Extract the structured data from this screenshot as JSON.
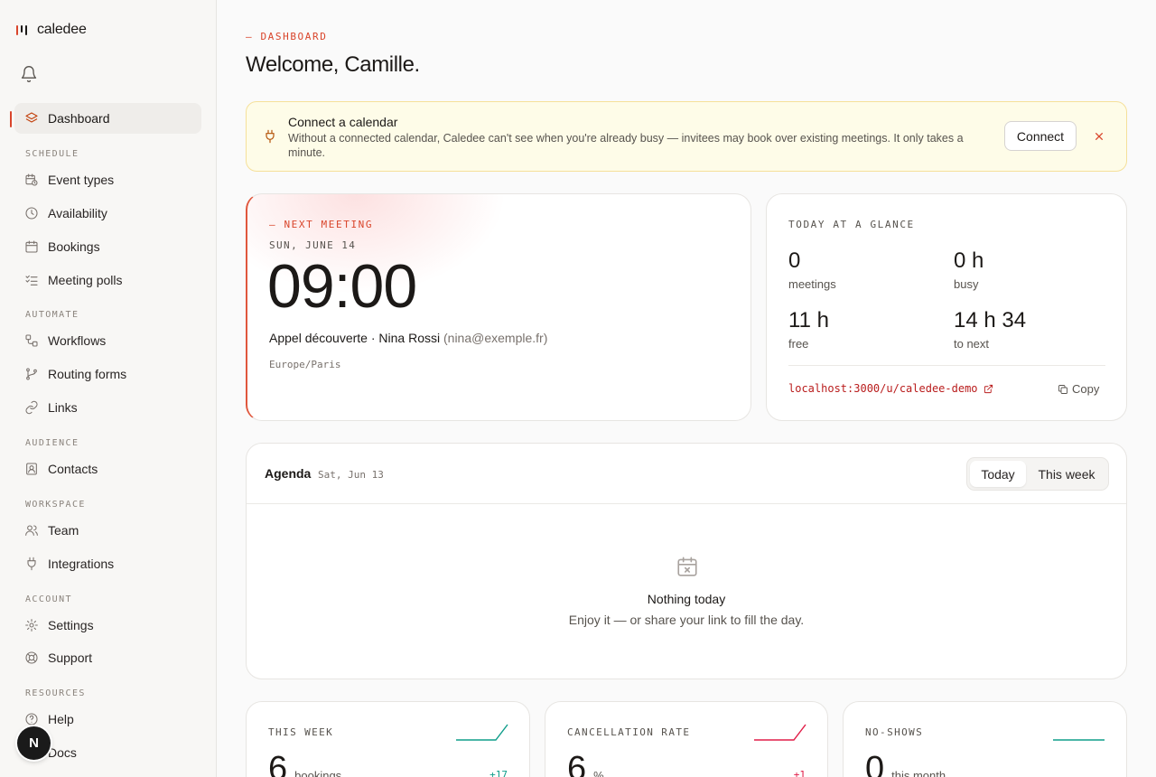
{
  "brand": {
    "name": "caledee"
  },
  "colors": {
    "accent": "#d9452b",
    "positive": "#0f9d8a",
    "negative": "#e11d48",
    "warning_bg": "#fefce8"
  },
  "sidebar": {
    "items": [
      {
        "key": "dashboard",
        "label": "Dashboard",
        "icon": "layers-icon",
        "active": true
      },
      {
        "key": "event-types",
        "label": "Event types",
        "icon": "calendar-clock-icon"
      },
      {
        "key": "availability",
        "label": "Availability",
        "icon": "clock-icon"
      },
      {
        "key": "bookings",
        "label": "Bookings",
        "icon": "calendar-icon"
      },
      {
        "key": "meeting-polls",
        "label": "Meeting polls",
        "icon": "checklist-icon"
      },
      {
        "key": "workflows",
        "label": "Workflows",
        "icon": "workflow-icon"
      },
      {
        "key": "routing-forms",
        "label": "Routing forms",
        "icon": "git-branch-icon"
      },
      {
        "key": "links",
        "label": "Links",
        "icon": "link-icon"
      },
      {
        "key": "contacts",
        "label": "Contacts",
        "icon": "contact-icon"
      },
      {
        "key": "team",
        "label": "Team",
        "icon": "users-icon"
      },
      {
        "key": "integrations",
        "label": "Integrations",
        "icon": "plug-icon"
      },
      {
        "key": "settings",
        "label": "Settings",
        "icon": "gear-icon"
      },
      {
        "key": "support",
        "label": "Support",
        "icon": "life-buoy-icon"
      },
      {
        "key": "help",
        "label": "Help",
        "icon": "help-circle-icon"
      },
      {
        "key": "docs",
        "label": "Docs",
        "icon": "book-icon"
      }
    ],
    "sections": {
      "schedule": "SCHEDULE",
      "automate": "AUTOMATE",
      "audience": "AUDIENCE",
      "workspace": "WORKSPACE",
      "account": "ACCOUNT",
      "resources": "RESOURCES"
    },
    "avatar_initial": "N"
  },
  "header": {
    "eyebrow": "— DASHBOARD",
    "title": "Welcome, Camille."
  },
  "banner": {
    "title": "Connect a calendar",
    "text": "Without a connected calendar, Caledee can't see when you're already busy — invitees may book over existing meetings. It only takes a minute.",
    "button": "Connect"
  },
  "next_meeting": {
    "label": "— NEXT MEETING",
    "date": "SUN, JUNE 14",
    "time": "09:00",
    "title": "Appel découverte · Nina Rossi",
    "email": "(nina@exemple.fr)",
    "timezone": "Europe/Paris"
  },
  "glance": {
    "label": "TODAY AT A GLANCE",
    "stats": [
      {
        "value": "0",
        "label": "meetings"
      },
      {
        "value": "0 h",
        "label": "busy"
      },
      {
        "value": "11 h",
        "label": "free"
      },
      {
        "value": "14 h 34",
        "label": "to next"
      }
    ],
    "link": "localhost:3000/u/caledee-demo",
    "copy": "Copy"
  },
  "agenda": {
    "title": "Agenda",
    "date": "Sat, Jun 13",
    "tabs": [
      "Today",
      "This week"
    ],
    "selected_tab": "Today",
    "empty_title": "Nothing today",
    "empty_text": "Enjoy it — or share your link to fill the day."
  },
  "metrics": [
    {
      "label": "THIS WEEK",
      "value": "6",
      "unit": "bookings",
      "delta": "+17",
      "trend": "positive"
    },
    {
      "label": "CANCELLATION RATE",
      "value": "6",
      "unit": "%",
      "delta": "+1",
      "trend": "negative"
    },
    {
      "label": "NO-SHOWS",
      "value": "0",
      "unit": "this month",
      "delta": "",
      "trend": "positive"
    }
  ]
}
